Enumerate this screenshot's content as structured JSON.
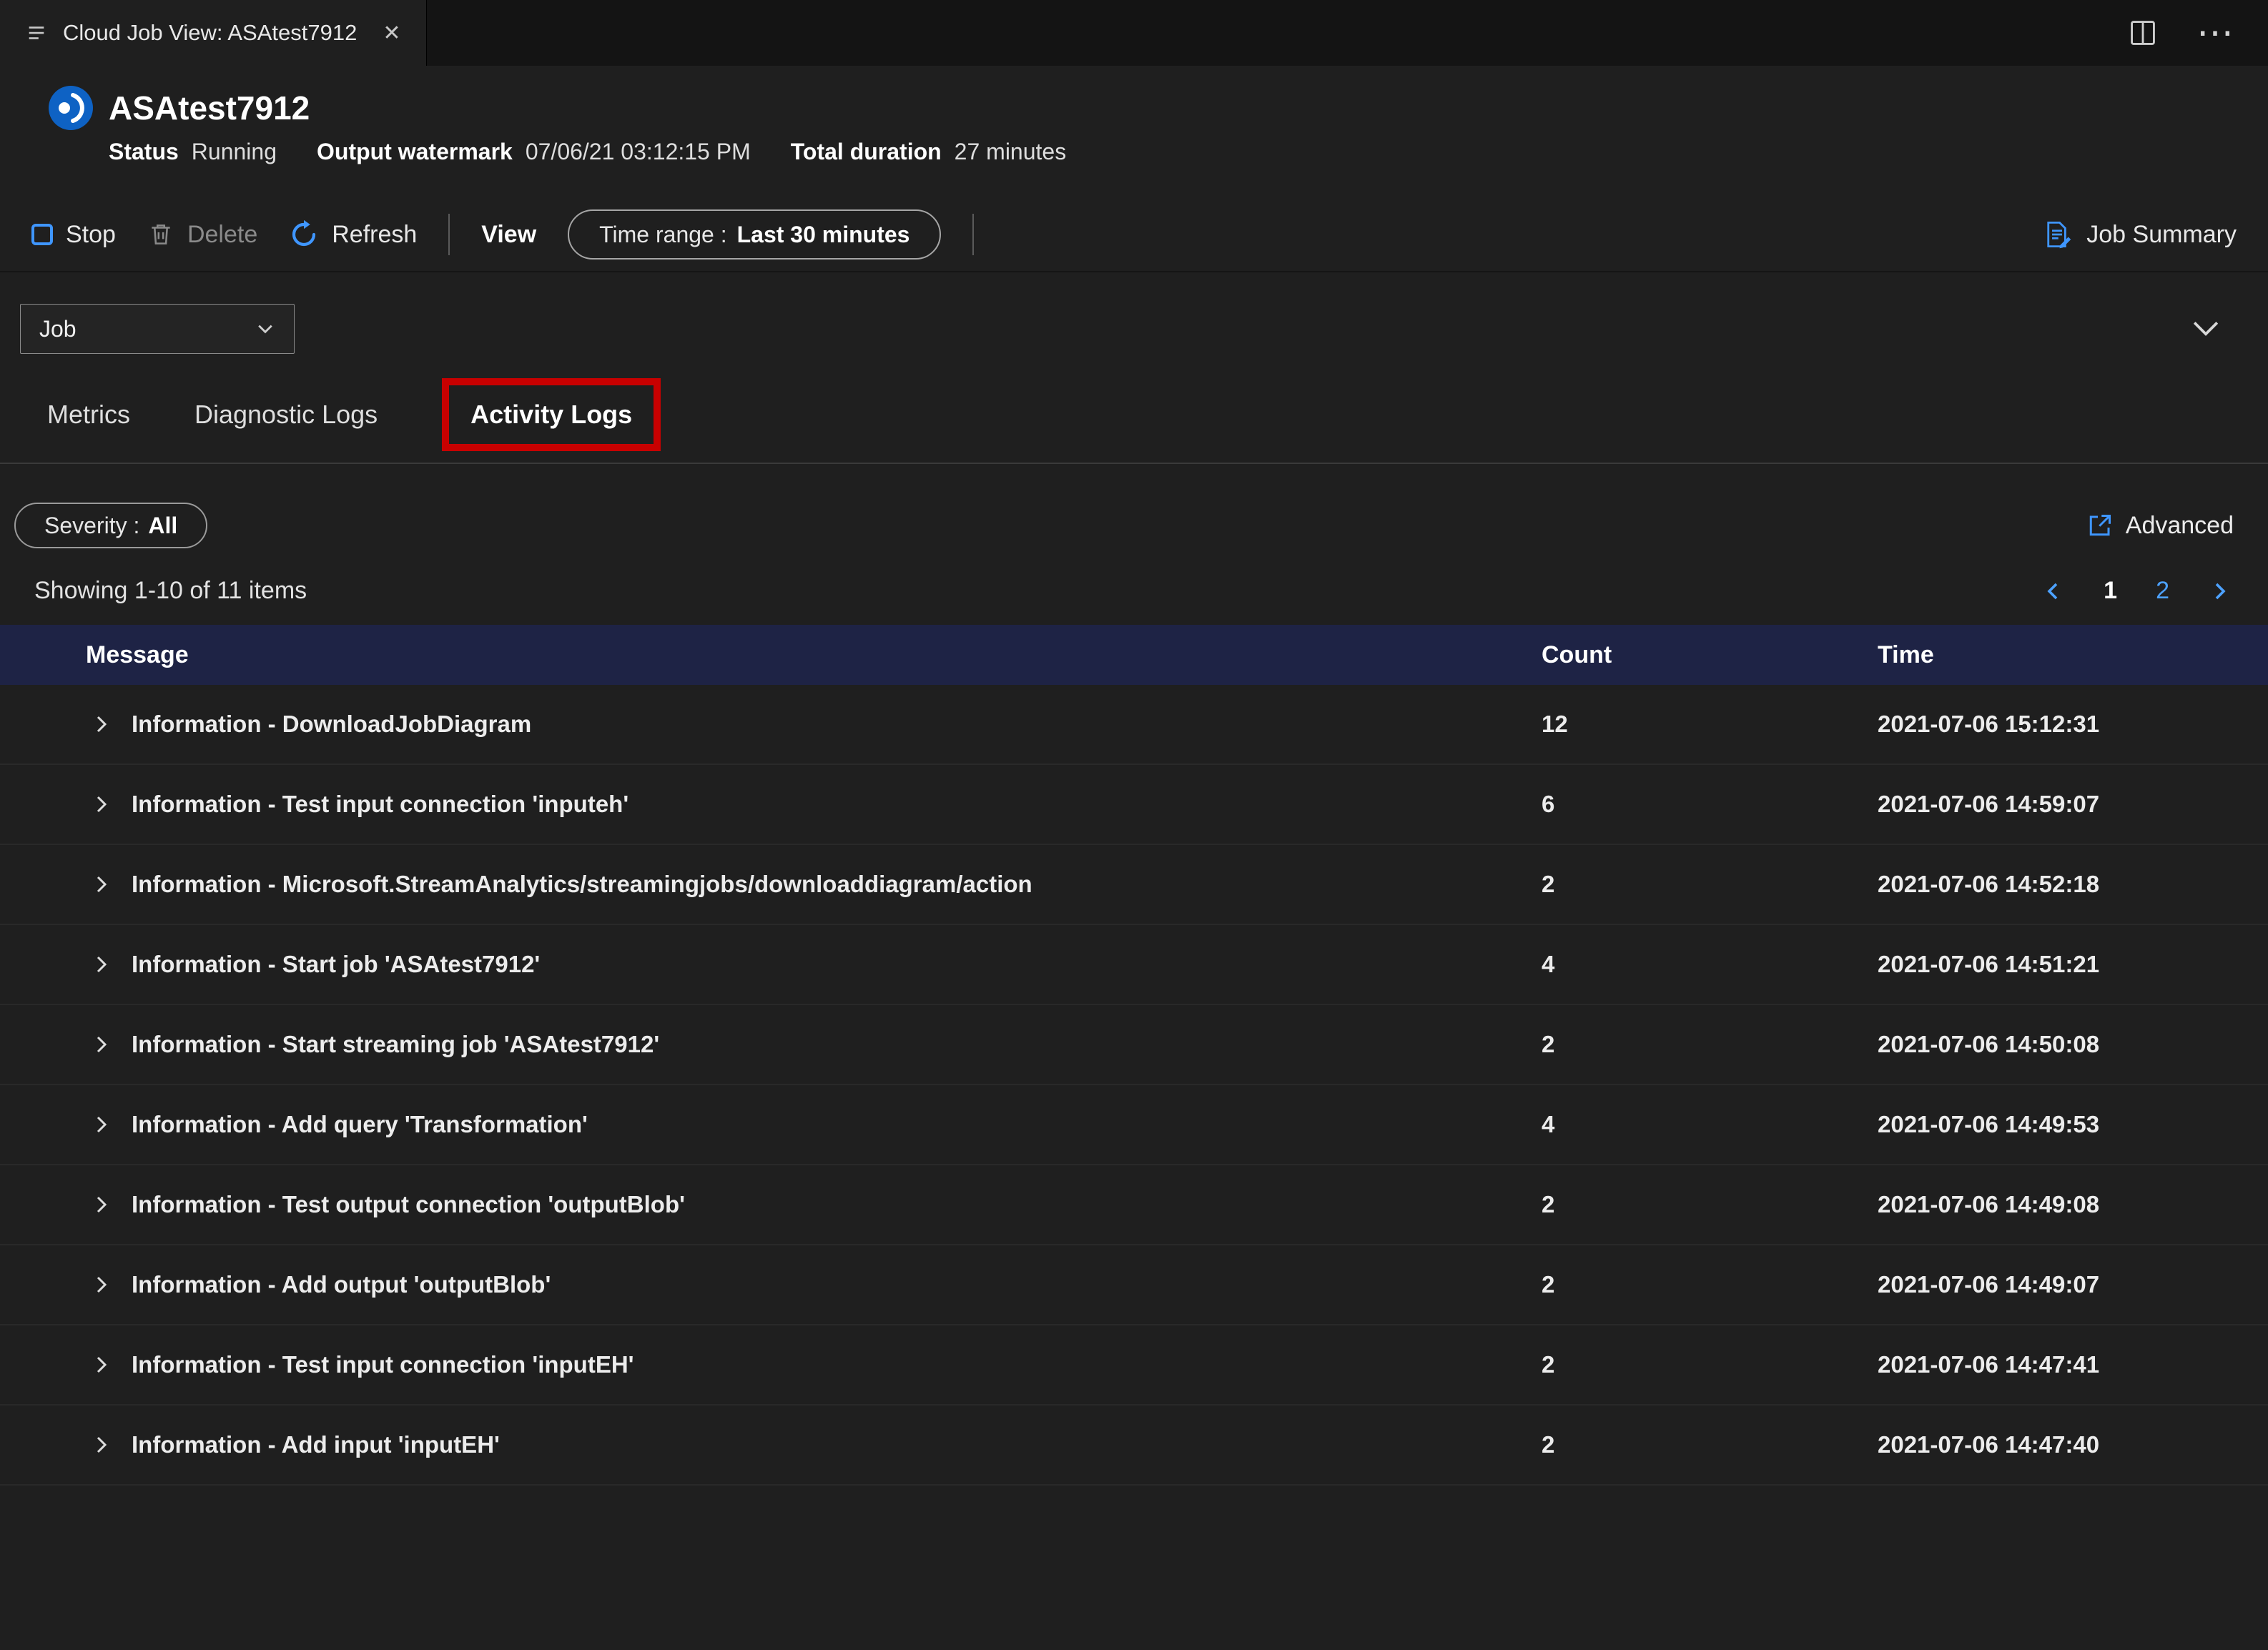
{
  "titlebar": {
    "tab_title": "Cloud Job View: ASAtest7912",
    "close_glyph": "✕",
    "more_glyph": "⋯"
  },
  "header": {
    "title": "ASAtest7912",
    "status_label": "Status",
    "status_value": "Running",
    "watermark_label": "Output watermark",
    "watermark_value": "07/06/21 03:12:15 PM",
    "duration_label": "Total duration",
    "duration_value": "27 minutes"
  },
  "toolbar": {
    "stop_label": "Stop",
    "delete_label": "Delete",
    "refresh_label": "Refresh",
    "view_label": "View",
    "time_range_label": "Time range :",
    "time_range_value": "Last 30 minutes",
    "job_summary_label": "Job Summary"
  },
  "panel": {
    "job_dropdown_value": "Job"
  },
  "tabs": [
    {
      "label": "Metrics",
      "active": false
    },
    {
      "label": "Diagnostic Logs",
      "active": false
    },
    {
      "label": "Activity Logs",
      "active": true
    }
  ],
  "filters": {
    "severity_label": "Severity :",
    "severity_value": "All",
    "advanced_label": "Advanced"
  },
  "list": {
    "summary": "Showing 1-10 of 11 items"
  },
  "pagination": {
    "page1": "1",
    "page2": "2"
  },
  "colors": {
    "accent_blue": "#3f96ff",
    "link_blue": "#4da2ff",
    "table_header_bg": "#1e2345",
    "annotation_red": "#c80000"
  },
  "table": {
    "columns": [
      "Message",
      "Count",
      "Time"
    ],
    "rows": [
      {
        "message": "Information - DownloadJobDiagram",
        "count": "12",
        "time": "2021-07-06 15:12:31"
      },
      {
        "message": "Information - Test input connection 'inputeh'",
        "count": "6",
        "time": "2021-07-06 14:59:07"
      },
      {
        "message": "Information - Microsoft.StreamAnalytics/streamingjobs/downloaddiagram/action",
        "count": "2",
        "time": "2021-07-06 14:52:18"
      },
      {
        "message": "Information - Start job 'ASAtest7912'",
        "count": "4",
        "time": "2021-07-06 14:51:21"
      },
      {
        "message": "Information - Start streaming job 'ASAtest7912'",
        "count": "2",
        "time": "2021-07-06 14:50:08"
      },
      {
        "message": "Information - Add query 'Transformation'",
        "count": "4",
        "time": "2021-07-06 14:49:53"
      },
      {
        "message": "Information - Test output connection 'outputBlob'",
        "count": "2",
        "time": "2021-07-06 14:49:08"
      },
      {
        "message": "Information - Add output 'outputBlob'",
        "count": "2",
        "time": "2021-07-06 14:49:07"
      },
      {
        "message": "Information - Test input connection 'inputEH'",
        "count": "2",
        "time": "2021-07-06 14:47:41"
      },
      {
        "message": "Information - Add input 'inputEH'",
        "count": "2",
        "time": "2021-07-06 14:47:40"
      }
    ]
  }
}
